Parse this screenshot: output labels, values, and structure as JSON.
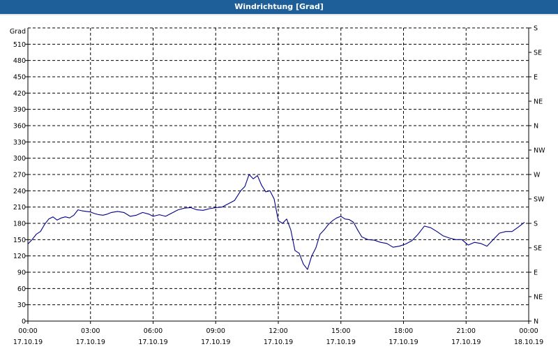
{
  "window": {
    "title": "Windrichtung [Grad]"
  },
  "chart_data": {
    "type": "line",
    "title": "Windrichtung [Grad]",
    "ylabel": "Grad",
    "ylim": [
      0,
      540
    ],
    "yticks": [
      0,
      30,
      60,
      90,
      120,
      150,
      180,
      210,
      240,
      270,
      300,
      330,
      360,
      390,
      420,
      450,
      480,
      510
    ],
    "right_axis_labels": [
      {
        "value": 0,
        "label": "N"
      },
      {
        "value": 45,
        "label": "NE"
      },
      {
        "value": 90,
        "label": "E"
      },
      {
        "value": 135,
        "label": "SE"
      },
      {
        "value": 180,
        "label": "S"
      },
      {
        "value": 225,
        "label": "SW"
      },
      {
        "value": 270,
        "label": "W"
      },
      {
        "value": 315,
        "label": "NW"
      },
      {
        "value": 360,
        "label": "N"
      },
      {
        "value": 405,
        "label": "NE"
      },
      {
        "value": 450,
        "label": "E"
      },
      {
        "value": 495,
        "label": "SE"
      },
      {
        "value": 540,
        "label": "S"
      }
    ],
    "xlim_hours": [
      0,
      24
    ],
    "xticks": [
      {
        "hour": 0,
        "time": "00:00",
        "date": "17.10.19"
      },
      {
        "hour": 3,
        "time": "03:00",
        "date": "17.10.19"
      },
      {
        "hour": 6,
        "time": "06:00",
        "date": "17.10.19"
      },
      {
        "hour": 9,
        "time": "09:00",
        "date": "17.10.19"
      },
      {
        "hour": 12,
        "time": "12:00",
        "date": "17.10.19"
      },
      {
        "hour": 15,
        "time": "15:00",
        "date": "17.10.19"
      },
      {
        "hour": 18,
        "time": "18:00",
        "date": "17.10.19"
      },
      {
        "hour": 21,
        "time": "21:00",
        "date": "17.10.19"
      },
      {
        "hour": 24,
        "time": "00:00",
        "date": "18.10.19"
      }
    ],
    "grid": true,
    "line_color": "#00008b",
    "series": [
      {
        "x": [
          0.0,
          0.2,
          0.4,
          0.6,
          0.8,
          1.0,
          1.2,
          1.4,
          1.6,
          1.8,
          2.0,
          2.2,
          2.4,
          2.6,
          2.8,
          3.0,
          3.2,
          3.4,
          3.6,
          3.8,
          4.0,
          4.3,
          4.6,
          4.9,
          5.2,
          5.5,
          5.8,
          6.0,
          6.3,
          6.6,
          6.9,
          7.2,
          7.5,
          7.8,
          8.1,
          8.4,
          8.7,
          9.0,
          9.3,
          9.6,
          9.9,
          10.2,
          10.4,
          10.6,
          10.8,
          11.0,
          11.2,
          11.4,
          11.6,
          11.8,
          12.0,
          12.2,
          12.4,
          12.6,
          12.8,
          13.0,
          13.2,
          13.4,
          13.6,
          13.8,
          14.0,
          14.2,
          14.4,
          14.6,
          14.8,
          15.0,
          15.2,
          15.4,
          15.6,
          15.8,
          16.0,
          16.3,
          16.6,
          16.9,
          17.2,
          17.5,
          17.8,
          18.1,
          18.4,
          18.7,
          19.0,
          19.3,
          19.6,
          19.9,
          20.2,
          20.5,
          20.8,
          21.1,
          21.4,
          21.7,
          22.0,
          22.3,
          22.6,
          22.9,
          23.2,
          23.5,
          23.8
        ],
        "y": [
          142,
          150,
          160,
          165,
          178,
          188,
          192,
          186,
          190,
          192,
          190,
          195,
          205,
          203,
          202,
          201,
          198,
          196,
          195,
          197,
          200,
          202,
          200,
          193,
          195,
          200,
          197,
          193,
          196,
          193,
          199,
          205,
          208,
          209,
          205,
          204,
          207,
          209,
          210,
          216,
          222,
          240,
          248,
          270,
          262,
          268,
          250,
          238,
          240,
          225,
          185,
          180,
          188,
          168,
          130,
          125,
          105,
          95,
          120,
          135,
          160,
          168,
          178,
          185,
          190,
          193,
          188,
          187,
          182,
          168,
          155,
          150,
          149,
          145,
          143,
          136,
          138,
          142,
          148,
          160,
          175,
          172,
          165,
          157,
          153,
          150,
          150,
          140,
          145,
          143,
          138,
          150,
          162,
          165,
          165,
          173,
          182
        ]
      }
    ]
  }
}
